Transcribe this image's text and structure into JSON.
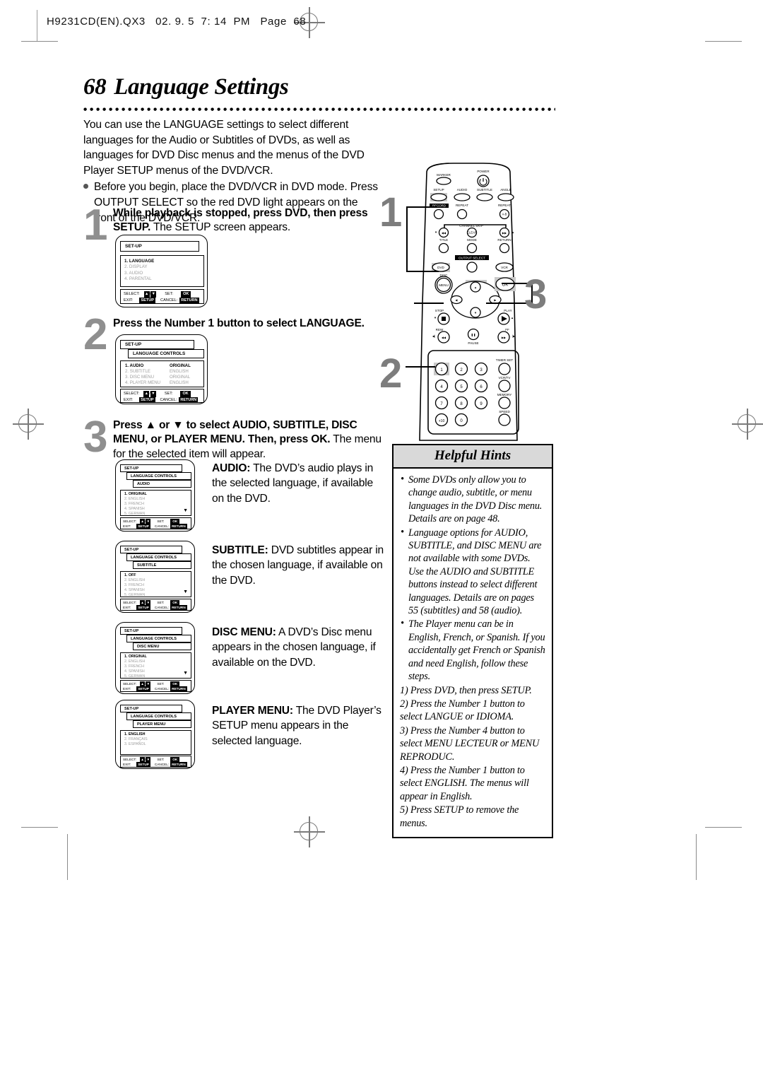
{
  "page_header": "H9231CD(EN).QX3   02. 9. 5  7: 14  PM   Page  68",
  "title": {
    "number": "68",
    "text": "Language Settings"
  },
  "intro": {
    "paragraph": "You can use the LANGUAGE settings to select different languages for the Audio or Subtitles of DVDs, as well as languages for DVD Disc menus and the menus of the DVD Player SETUP menus of the DVD/VCR.",
    "bullet": "Before you begin, place the DVD/VCR in DVD mode. Press OUTPUT SELECT so the red DVD light  appears on the front of the DVD/VCR."
  },
  "steps": [
    {
      "number": "1",
      "bold": "While playback is stopped, press DVD, then press SETUP.",
      "rest": " The SETUP screen appears."
    },
    {
      "number": "2",
      "bold": "Press the Number 1 button to select LANGUAGE.",
      "rest": ""
    },
    {
      "number": "3",
      "bold": "Press ▲ or ▼ to select AUDIO, SUBTITLE, DISC MENU, or PLAYER MENU. Then, press OK.",
      "rest": " The menu for the selected item will appear."
    }
  ],
  "osd_common": {
    "select_label": "SELECT:",
    "set_label": "SET:",
    "exit_label": "EXIT:",
    "cancel_label": "CANCEL:",
    "up_key": "▲",
    "down_key": "▼",
    "slash": "/",
    "ok_key": "OK",
    "setup_key": "SETUP",
    "return_key": "RETURN",
    "setup_title": "SET-UP",
    "language_controls": "LANGUAGE CONTROLS",
    "scroll_caret": "▼"
  },
  "osd_screens": [
    {
      "id": "setup-main",
      "bars": [
        "SET-UP"
      ],
      "rows": [
        {
          "label": "1. LANGUAGE",
          "value": "",
          "state": "first"
        },
        {
          "label": "2. DISPLAY",
          "value": "",
          "state": "dim"
        },
        {
          "label": "3. AUDIO",
          "value": "",
          "state": "dim"
        },
        {
          "label": "4. PARENTAL",
          "value": "",
          "state": "dim"
        }
      ],
      "caret": false
    },
    {
      "id": "language-controls",
      "bars": [
        "SET-UP",
        "LANGUAGE CONTROLS"
      ],
      "rows": [
        {
          "label": "1. AUDIO",
          "value": "ORIGINAL",
          "state": "first"
        },
        {
          "label": "2. SUBTITLE",
          "value": "ENGLISH",
          "state": "dim"
        },
        {
          "label": "3. DISC MENU",
          "value": "ORIGINAL",
          "state": "dim"
        },
        {
          "label": "4. PLAYER MENU",
          "value": "ENGLISH",
          "state": "dim"
        }
      ],
      "caret": false
    },
    {
      "id": "audio-menu",
      "bars": [
        "SET-UP",
        "LANGUAGE CONTROLS",
        "AUDIO"
      ],
      "rows": [
        {
          "label": "1. ORIGINAL",
          "value": "",
          "state": "first"
        },
        {
          "label": "2. ENGLISH",
          "value": "",
          "state": "dim"
        },
        {
          "label": "3. FRENCH",
          "value": "",
          "state": "dim"
        },
        {
          "label": "4. SPANISH",
          "value": "",
          "state": "dim"
        },
        {
          "label": "5. GERMAN",
          "value": "",
          "state": "dim"
        }
      ],
      "caret": true
    },
    {
      "id": "subtitle-menu",
      "bars": [
        "SET-UP",
        "LANGUAGE CONTROLS",
        "SUBTITLE"
      ],
      "rows": [
        {
          "label": "1. OFF",
          "value": "",
          "state": "first"
        },
        {
          "label": "2. ENGLISH",
          "value": "",
          "state": "dim"
        },
        {
          "label": "3. FRENCH",
          "value": "",
          "state": "dim"
        },
        {
          "label": "4. SPANISH",
          "value": "",
          "state": "dim"
        },
        {
          "label": "5. GERMAN",
          "value": "",
          "state": "dim"
        }
      ],
      "caret": true
    },
    {
      "id": "disc-menu",
      "bars": [
        "SET-UP",
        "LANGUAGE CONTROLS",
        "DISC MENU"
      ],
      "rows": [
        {
          "label": "1. ORIGINAL",
          "value": "",
          "state": "first"
        },
        {
          "label": "2. ENGLISH",
          "value": "",
          "state": "dim"
        },
        {
          "label": "3. FRENCH",
          "value": "",
          "state": "dim"
        },
        {
          "label": "4. SPANISH",
          "value": "",
          "state": "dim"
        },
        {
          "label": "5. GERMAN",
          "value": "",
          "state": "dim"
        }
      ],
      "caret": true
    },
    {
      "id": "player-menu",
      "bars": [
        "SET-UP",
        "LANGUAGE CONTROLS",
        "PLAYER MENU"
      ],
      "rows": [
        {
          "label": "1. ENGLISH",
          "value": "",
          "state": "first"
        },
        {
          "label": "2. FRANÇAIS",
          "value": "",
          "state": "dim"
        },
        {
          "label": "3. ESPAÑOL",
          "value": "",
          "state": "dim"
        }
      ],
      "caret": false
    }
  ],
  "descriptions": [
    {
      "term": "AUDIO:",
      "text": " The DVD’s audio plays in the selected language, if available on the DVD."
    },
    {
      "term": "SUBTITLE:",
      "text": " DVD subtitles appear in the chosen language, if available on the DVD."
    },
    {
      "term": "DISC MENU:",
      "text": " A DVD’s Disc menu appears in the chosen language, if available on the DVD."
    },
    {
      "term": "PLAYER MENU:",
      "text": " The DVD Player’s SETUP menu appears in the selected language."
    }
  ],
  "hints": {
    "title": "Helpful Hints",
    "bullet_glyph": "•",
    "items": [
      "Some DVDs only allow you to change audio, subtitle, or menu languages in the DVD Disc menu. Details are on page 48.",
      "Language options for AUDIO, SUBTITLE, and DISC MENU are not available with some DVDs. Use the AUDIO and SUBTITLE buttons instead to select different languages. Details are on pages 55 (subtitles) and 58 (audio).",
      "The Player menu can be in English, French, or Spanish. If you accidentally get French or Spanish and need English, follow these steps."
    ],
    "numbered": [
      "1) Press DVD, then press SETUP.",
      "2) Press the Number 1 button to select LANGUE or IDIOMA.",
      "3) Press the Number 4 button to select MENU LECTEUR or MENU REPRODUC.",
      "4) Press the Number 1 button to select ENGLISH. The menus will appear in English.",
      "5) Press SETUP to remove the menus."
    ]
  },
  "remote": {
    "callouts": [
      "1",
      "2",
      "3"
    ],
    "buttons": {
      "marker": "MARKER",
      "power": "POWER",
      "setup": "SETUP",
      "audio": "AUDIO",
      "subtitle": "SUBTITLE",
      "angle": "ANGLE",
      "record": "RECORD",
      "repeat": "REPEAT",
      "repeat_ab": "REPEAT",
      "repeat_ab_sub": "A-B",
      "channel_skip": "CHANNEL SKIP",
      "title": "TITLE",
      "clear": "CLEAR",
      "mode": "MODE",
      "return": "RETURN",
      "output_select": "OUTPUT SELECT",
      "dvd": "DVD",
      "vcr": "VCR",
      "disc": "DISC",
      "menu": "MENU",
      "ok": "OK",
      "stop": "STOP",
      "play": "PLAY",
      "rew": "REW",
      "pause": "PAUSE",
      "ff": "FF",
      "timer_set": "TIMER SET",
      "vcr_tv": "VCR/TV",
      "memory": "MEMORY",
      "speed": "SPEED"
    },
    "numpad": [
      "1",
      "2",
      "3",
      "4",
      "5",
      "6",
      "7",
      "8",
      "9",
      "+10",
      "0"
    ]
  },
  "colors": {
    "highlight": "#c9c9c9",
    "step_number": "#8f8f8f",
    "hints_header": "#d9d9d9"
  }
}
